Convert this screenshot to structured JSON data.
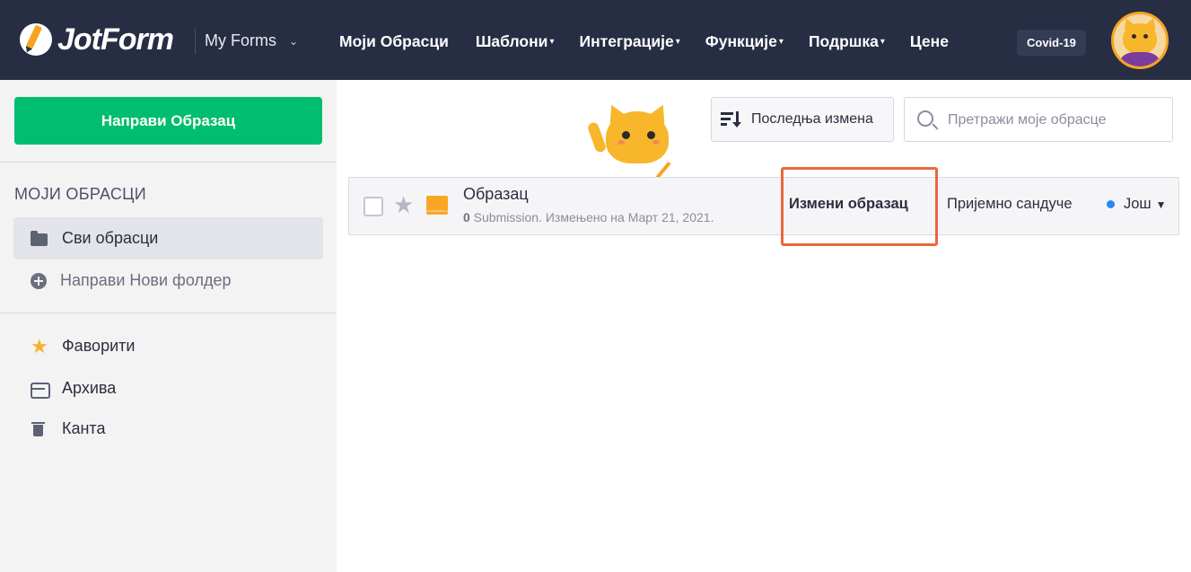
{
  "header": {
    "logo_text": "JotForm",
    "myforms_label": "My Forms",
    "nav": [
      {
        "label": "Моји Обрасци",
        "caret": ""
      },
      {
        "label": "Шаблони",
        "caret": "▾"
      },
      {
        "label": "Интеграције",
        "caret": "▾"
      },
      {
        "label": "Функције",
        "caret": "▾"
      },
      {
        "label": "Подршка",
        "caret": "▾"
      },
      {
        "label": "Цене",
        "caret": ""
      }
    ],
    "covid_badge": "Covid-19"
  },
  "sidebar": {
    "create_button": "Направи Образац",
    "section_title": "МОЈИ ОБРАСЦИ",
    "items": [
      {
        "label": "Сви обрасци",
        "icon": "folder-icon"
      },
      {
        "label": "Направи Нови фолдер",
        "icon": "plus-circle-icon"
      },
      {
        "label": "Фаворити",
        "icon": "star-icon"
      },
      {
        "label": "Архива",
        "icon": "inbox-icon"
      },
      {
        "label": "Канта",
        "icon": "trash-icon"
      }
    ]
  },
  "toolbar": {
    "sort_label": "Последња измена",
    "search_placeholder": "Претражи моје обрасце"
  },
  "form": {
    "title": "Образац",
    "submission_count": "0",
    "meta": " Submission. Измењено на Март 21, 2021.",
    "edit_label": "Измени образац",
    "inbox_label": "Пријемно сандуче",
    "more_label": "Још"
  },
  "colors": {
    "topbar": "#272d43",
    "create_button": "#01bd6f",
    "highlight": "#e8683e",
    "status_dot": "#2b87f2"
  }
}
